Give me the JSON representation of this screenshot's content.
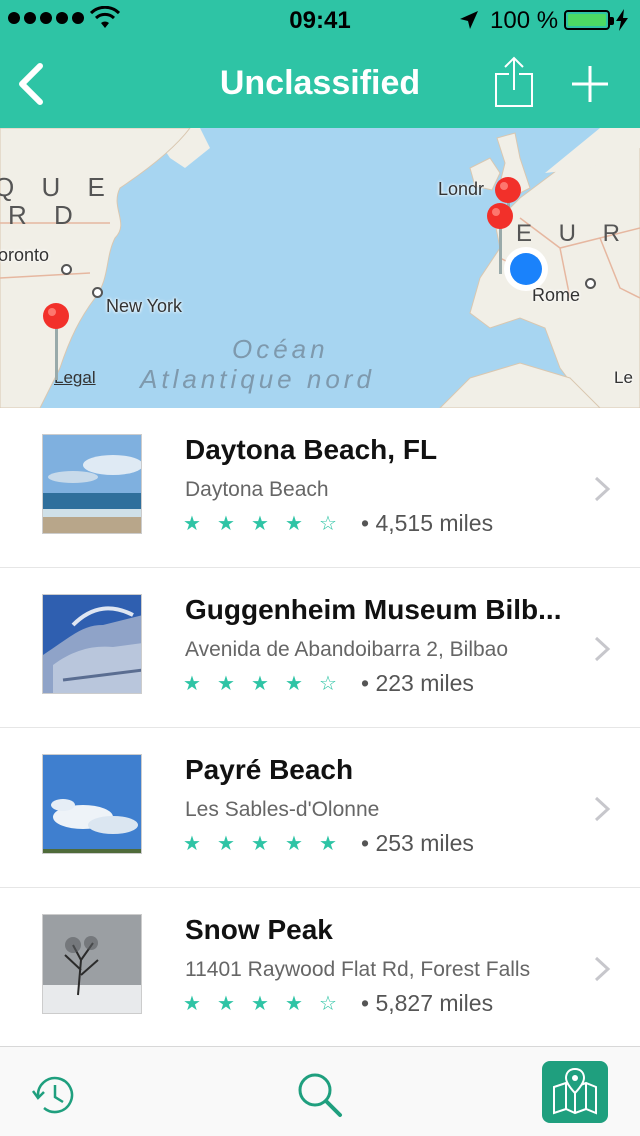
{
  "status_bar": {
    "time": "09:41",
    "battery_percent": "100 %",
    "signal_bars": 5
  },
  "nav": {
    "title": "Unclassified",
    "back_icon": "chevron-left-icon",
    "share_icon": "share-icon",
    "add_icon": "plus-icon"
  },
  "map": {
    "labels": {
      "region_left_1": "Q U E",
      "region_left_2": "R D",
      "toronto": "oronto",
      "new_york": "New York",
      "london": "Londr",
      "europe": "E U R O",
      "rome": "Rome",
      "ocean_1": "Océan",
      "ocean_2": "Atlantique nord",
      "le": "Le",
      "legal": "Legal"
    },
    "pin_count": 3
  },
  "places": [
    {
      "title": "Daytona Beach, FL",
      "subtitle": "Daytona Beach",
      "rating": 4,
      "distance": "4,515 miles",
      "thumb": "beach-ocean"
    },
    {
      "title": "Guggenheim Museum Bilb...",
      "subtitle": "Avenida de Abandoibarra 2, Bilbao",
      "rating": 4,
      "distance": "223 miles",
      "thumb": "museum-building"
    },
    {
      "title": "Payré Beach",
      "subtitle": "Les Sables-d'Olonne",
      "rating": 5,
      "distance": "253 miles",
      "thumb": "sky-clouds"
    },
    {
      "title": "Snow Peak",
      "subtitle": "11401 Raywood Flat Rd, Forest Falls",
      "rating": 4,
      "distance": "5,827 miles",
      "thumb": "snowy-tree"
    }
  ],
  "tab_bar": {
    "tabs": [
      {
        "icon": "history-icon",
        "active": false
      },
      {
        "icon": "search-icon",
        "active": false
      },
      {
        "icon": "map-icon",
        "active": true
      }
    ]
  },
  "colors": {
    "accent": "#2ec4a5",
    "accent_dark": "#1f9f7e",
    "pin_red": "#f2302a",
    "user_dot": "#1a82fb",
    "map_water": "#a7d5f1"
  }
}
